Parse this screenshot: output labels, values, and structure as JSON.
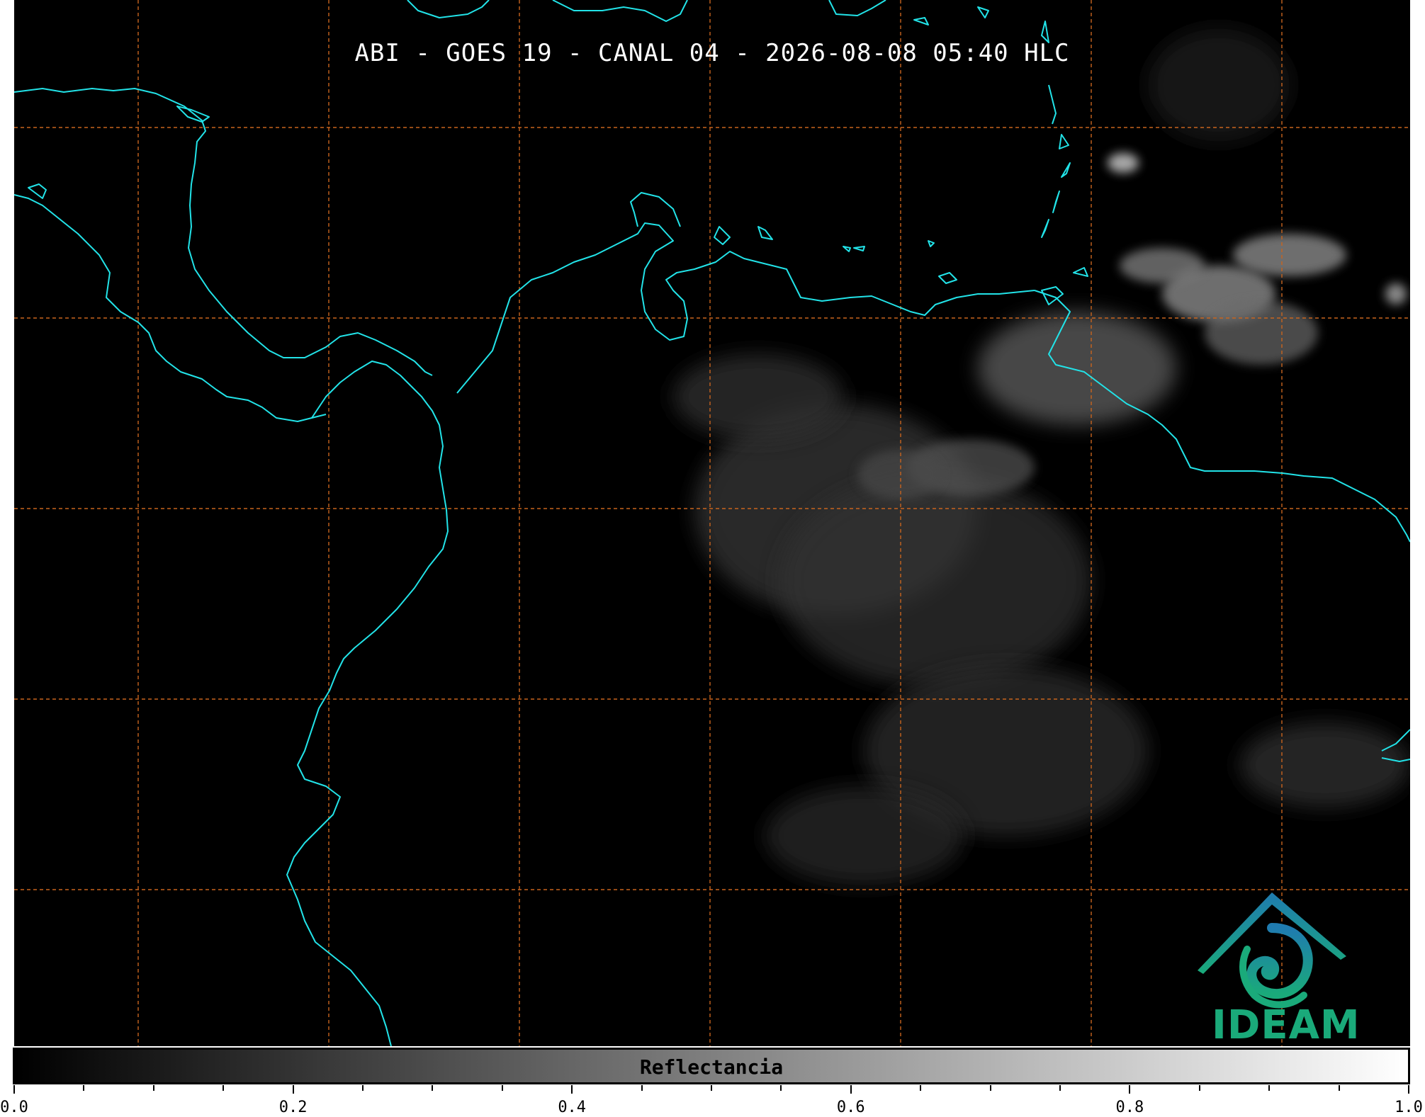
{
  "title": "ABI - GOES 19 - CANAL 04 - 2026-08-08 05:40 HLC",
  "colorbar": {
    "label": "Reflectancia",
    "range": [
      0.0,
      1.0
    ],
    "colormap": "black-to-white",
    "major_ticks": [
      "0.0",
      "0.2",
      "0.4",
      "0.6",
      "0.8",
      "1.0"
    ]
  },
  "logo": {
    "text": "IDEAM",
    "colors": [
      "#1f7bb0",
      "#1aaa7a"
    ]
  },
  "map": {
    "background": "#000000",
    "coastline_color": "#22e3e8",
    "gridline_color": "#c8641e",
    "gridlines": "dashed"
  }
}
